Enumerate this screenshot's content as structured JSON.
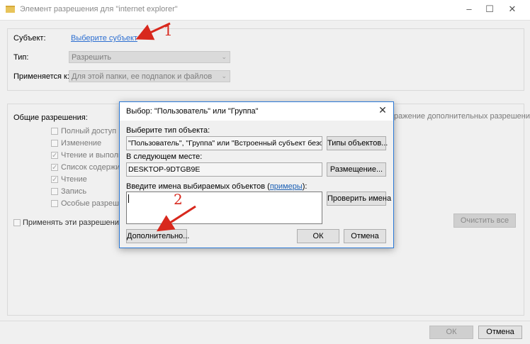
{
  "window": {
    "title": "Элемент разрешения для \"internet explorer\""
  },
  "subject": {
    "label": "Субъект:",
    "link": "Выберите субъект"
  },
  "type": {
    "label": "Тип:",
    "value": "Разрешить"
  },
  "applies": {
    "label": "Применяется к:",
    "value": "Для этой папки, ее подпапок и файлов"
  },
  "perms": {
    "header": "Общие разрешения:",
    "show_more": "ражение дополнительных разрешений",
    "items": [
      {
        "label": "Полный доступ",
        "checked": false
      },
      {
        "label": "Изменение",
        "checked": false
      },
      {
        "label": "Чтение и выполне",
        "checked": true
      },
      {
        "label": "Список содержим",
        "checked": true
      },
      {
        "label": "Чтение",
        "checked": true
      },
      {
        "label": "Запись",
        "checked": false
      },
      {
        "label": "Особые разрешен",
        "checked": false
      }
    ],
    "apply_only": "Применять эти разрешения к о",
    "clear_all": "Очистить все"
  },
  "footer": {
    "ok": "ОК",
    "cancel": "Отмена"
  },
  "dialog": {
    "title": "Выбор: \"Пользователь\" или \"Группа\"",
    "obj_type_label": "Выберите тип объекта:",
    "obj_type_value": "\"Пользователь\", \"Группа\" или \"Встроенный субъект безопасност",
    "obj_types_btn": "Типы объектов...",
    "location_label": "В следующем месте:",
    "location_value": "DESKTOP-9DTGB9E",
    "location_btn": "Размещение...",
    "names_label_prefix": "Введите имена выбираемых объектов (",
    "names_label_link": "примеры",
    "names_label_suffix": "):",
    "names_value": "",
    "check_btn": "Проверить имена",
    "advanced_btn": "Дополнительно...",
    "ok_btn": "ОК",
    "cancel_btn": "Отмена"
  },
  "annotations": {
    "one": "1",
    "two": "2"
  },
  "colors": {
    "accent": "#1a5fb4",
    "dialog_border": "#2b79d7",
    "annotation": "#d8281d"
  }
}
